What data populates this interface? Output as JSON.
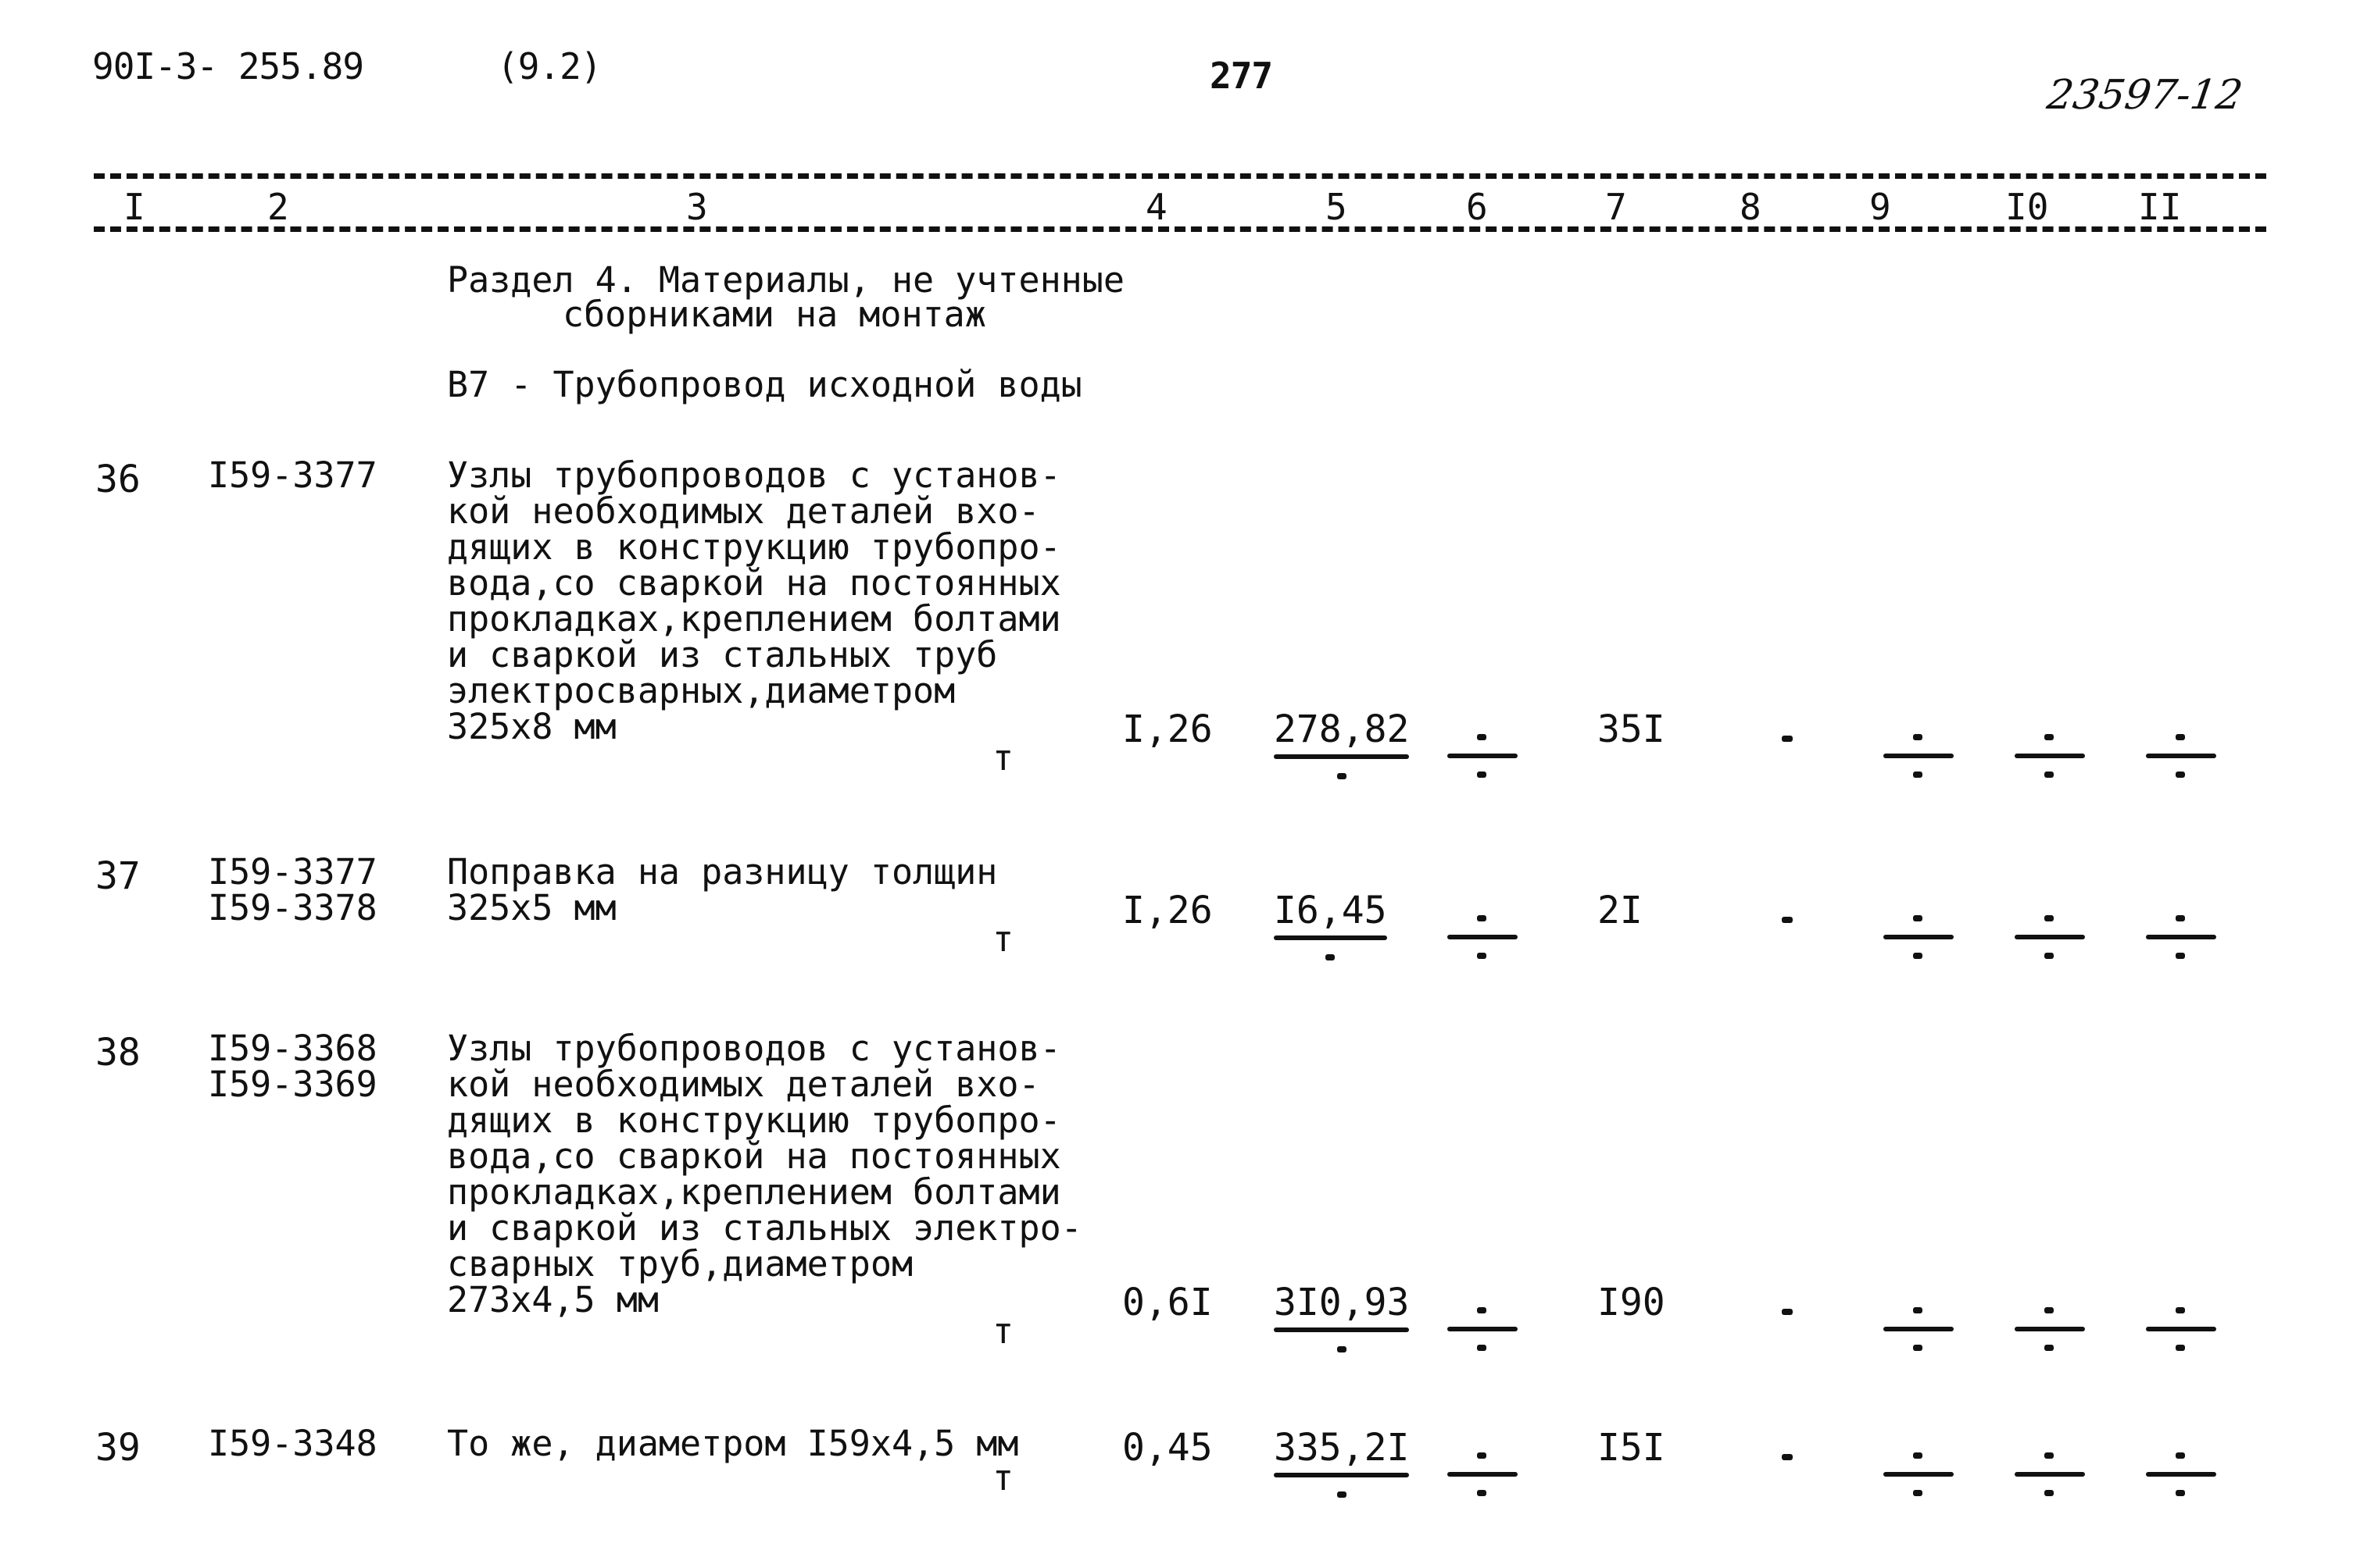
{
  "header": {
    "doc_code": "90I-3- 255.89",
    "section_ref": "(9.2)",
    "page_number": "277",
    "stamp": "23597-12"
  },
  "columns": [
    "I",
    "2",
    "3",
    "4",
    "5",
    "6",
    "7",
    "8",
    "9",
    "I0",
    "II"
  ],
  "section": {
    "title_line1": "Раздел 4. Материалы, не учтенные",
    "title_line2": "сборниками на монтаж",
    "subtitle": "В7 - Трубопровод исходной воды"
  },
  "rows": [
    {
      "no": "36",
      "codes": [
        "I59-3377"
      ],
      "description": [
        "Узлы трубопроводов с установ-",
        "кой необходимых деталей вхо-",
        "дящих в конструкцию трубопро-",
        "вода,со сваркой на постоянных",
        "прокладках,креплением болтами",
        "и сваркой из стальных труб",
        "электросварных,диаметром",
        "325х8 мм"
      ],
      "unit": "т",
      "c4": "I,26",
      "c5": "278,82",
      "c6": "-",
      "c7": "35I",
      "c8": "-",
      "c9": "-",
      "c10": "-",
      "c11": "-"
    },
    {
      "no": "37",
      "codes": [
        "I59-3377",
        "I59-3378"
      ],
      "description": [
        "Поправка на разницу толщин",
        "325х5 мм"
      ],
      "unit": "т",
      "c4": "I,26",
      "c5": "I6,45",
      "c6": "-",
      "c7": "2I",
      "c8": "-",
      "c9": "-",
      "c10": "-",
      "c11": "-"
    },
    {
      "no": "38",
      "codes": [
        "I59-3368",
        "I59-3369"
      ],
      "description": [
        "Узлы трубопроводов с установ-",
        "кой необходимых деталей вхо-",
        "дящих в конструкцию трубопро-",
        "вода,со сваркой на постоянных",
        "прокладках,креплением болтами",
        "и сваркой из стальных электро-",
        "сварных труб,диаметром",
        "273х4,5 мм"
      ],
      "unit": "т",
      "c4": "0,6I",
      "c5": "3I0,93",
      "c6": "-",
      "c7": "I90",
      "c8": "-",
      "c9": "-",
      "c10": "-",
      "c11": "-"
    },
    {
      "no": "39",
      "codes": [
        "I59-3348"
      ],
      "description": [
        "То же, диаметром I59х4,5 мм"
      ],
      "unit": "т",
      "c4": "0,45",
      "c5": "335,2I",
      "c6": "-",
      "c7": "I5I",
      "c8": "-",
      "c9": "-",
      "c10": "-",
      "c11": "-"
    }
  ]
}
